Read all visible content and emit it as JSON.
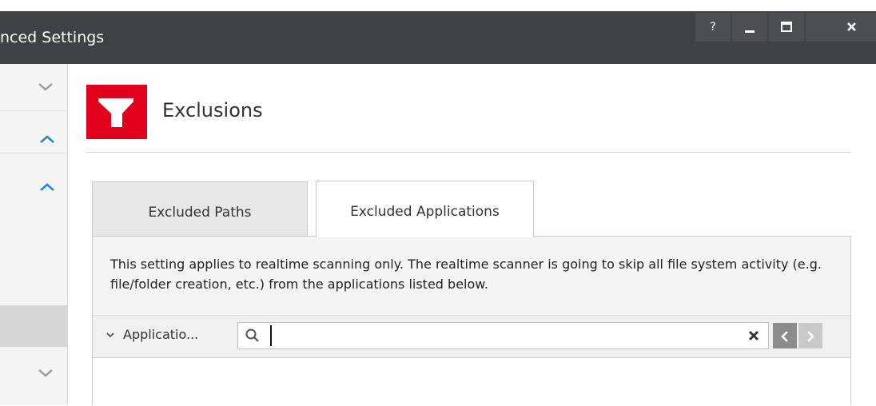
{
  "window": {
    "title": "nced Settings",
    "buttons": {
      "help": "?",
      "minimize": "minimize",
      "maximize": "maximize",
      "close": "close"
    }
  },
  "sidebar": {
    "items": [
      {
        "icon": "chevron-down-icon",
        "color": "#9a9a9a"
      },
      {
        "icon": "chevron-up-icon",
        "color": "#1e8bd4"
      },
      {
        "icon": "chevron-up-icon",
        "color": "#1e8bd4"
      },
      {
        "icon": "none",
        "selected": true
      },
      {
        "icon": "chevron-down-icon",
        "color": "#9a9a9a"
      }
    ]
  },
  "header": {
    "icon": "funnel-icon",
    "icon_color": "#e0001b",
    "title": "Exclusions"
  },
  "tabs": [
    {
      "label": "Excluded Paths",
      "active": false
    },
    {
      "label": "Excluded Applications",
      "active": true
    }
  ],
  "description": "This setting applies to realtime scanning only. The realtime scanner is going to skip all file system activity (e.g. file/folder creation, etc.) from the applications listed below.",
  "toolbar": {
    "column_selector": "Applicatio...",
    "search": {
      "value": "",
      "placeholder": ""
    },
    "prev_icon": "chevron-left-icon",
    "next_icon": "chevron-right-icon"
  },
  "list": {
    "rows": []
  }
}
